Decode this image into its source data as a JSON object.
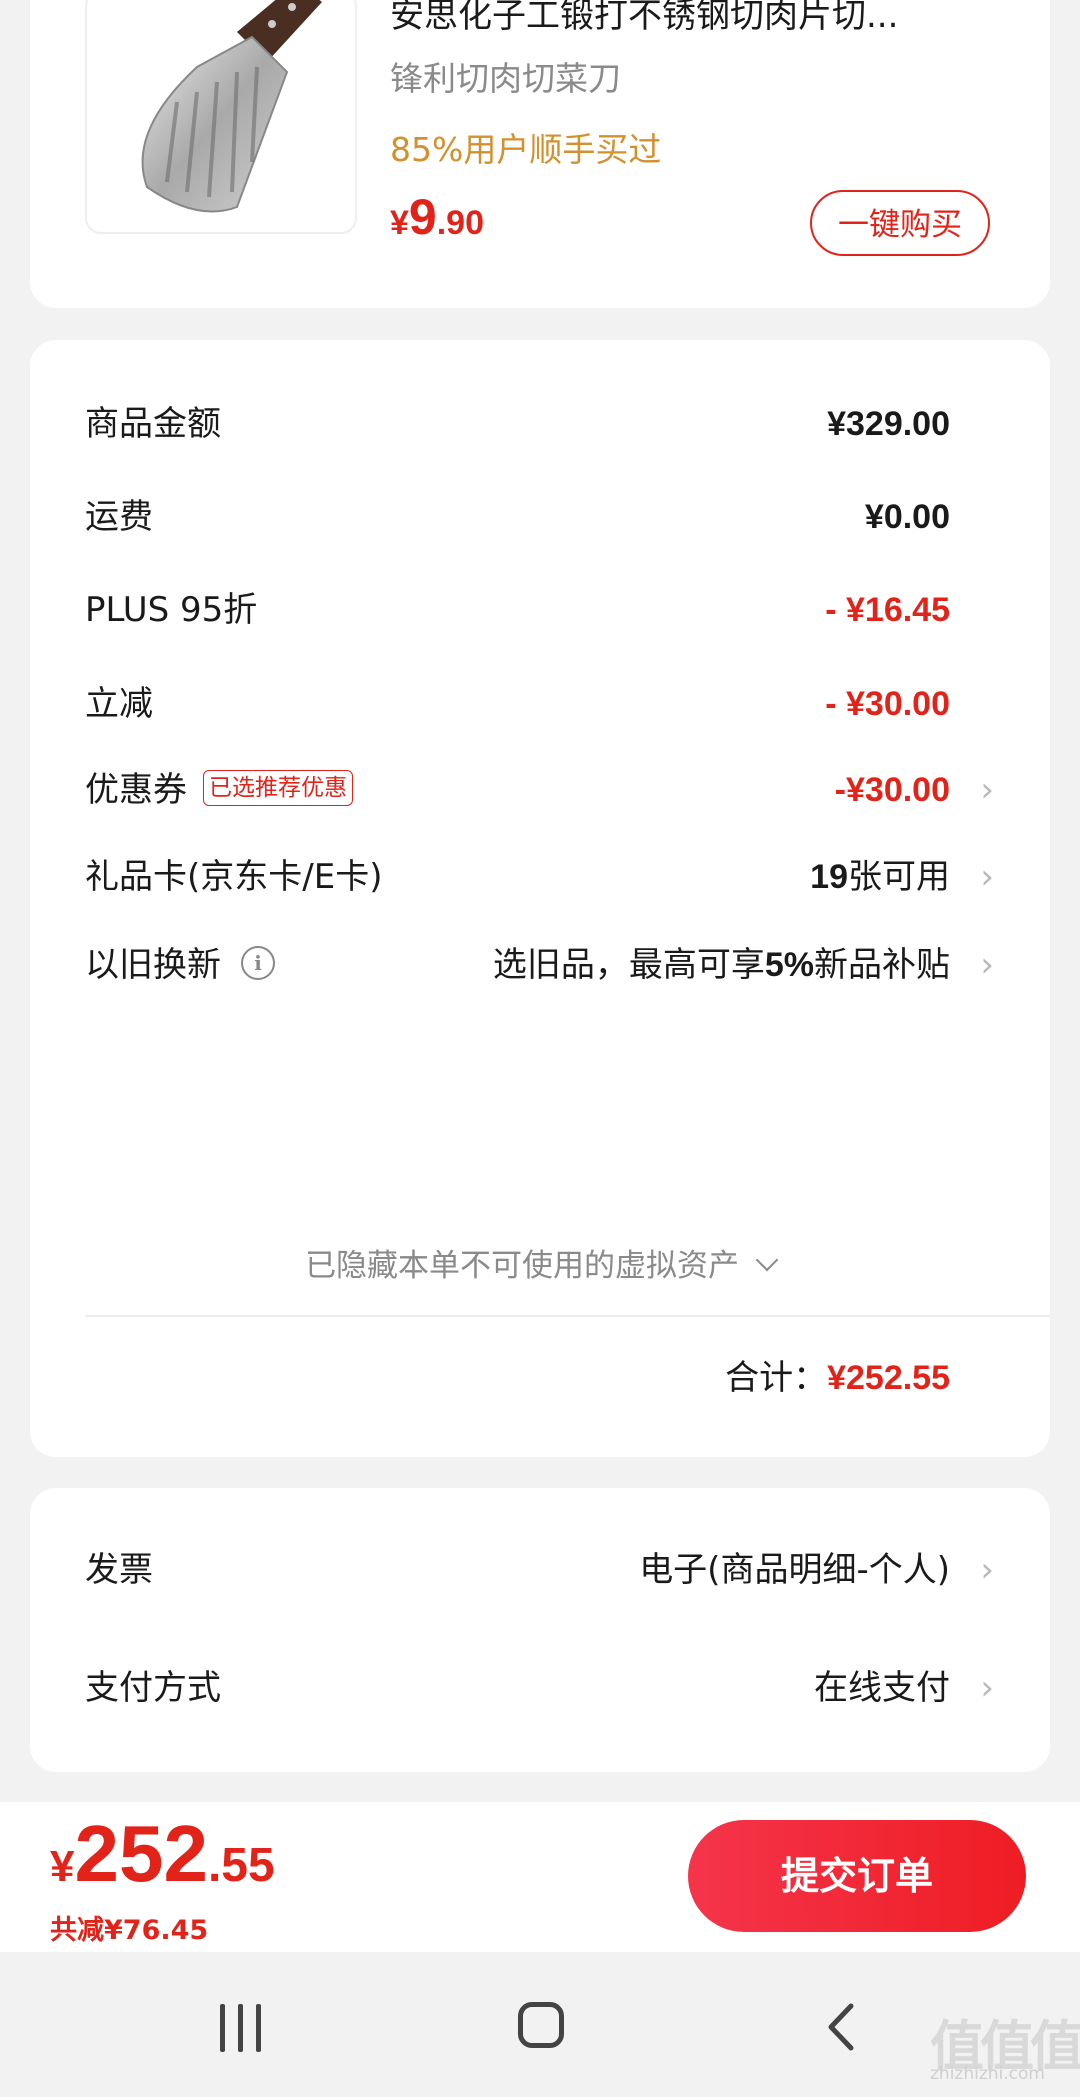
{
  "product": {
    "title": "安思化子工锻打不锈钢切肉片切...",
    "subtitle": "锋利切肉切菜刀",
    "tag": "85%用户顺手买过",
    "price_currency": "¥",
    "price_int": "9",
    "price_dec": ".90",
    "buy_label": "一键购买"
  },
  "summary": {
    "rows": [
      {
        "label": "商品金额",
        "value": "¥329.00"
      },
      {
        "label": "运费",
        "value": "¥0.00"
      },
      {
        "label": "PLUS 95折",
        "value": "- ¥16.45"
      },
      {
        "label": "立减",
        "value": "- ¥30.00"
      },
      {
        "label": "优惠券",
        "badge": "已选推荐优惠",
        "value": "-¥30.00"
      },
      {
        "label": "礼品卡(京东卡/E卡)",
        "value_num": "19",
        "value_text": "张可用"
      },
      {
        "label": "以旧换新",
        "value_pre": "选旧品，最高可享",
        "value_num": "5%",
        "value_post": "新品补贴"
      }
    ],
    "hidden_note": "已隐藏本单不可使用的虚拟资产",
    "total_label": "合计：",
    "total_value": "¥252.55"
  },
  "invoice": {
    "rows": [
      {
        "label": "发票",
        "value": "电子(商品明细-个人)"
      },
      {
        "label": "支付方式",
        "value": "在线支付"
      }
    ]
  },
  "bottom": {
    "currency": "¥",
    "price_int": "252",
    "price_dec": ".55",
    "saved": "共减¥76.45",
    "submit_label": "提交订单"
  },
  "watermark": {
    "logo": "值值值",
    "site": "zhizhizhi.com"
  },
  "colors": {
    "accent_red": "#e2231a",
    "tag_orange": "#d4902c",
    "background": "#f2f2f2"
  },
  "icons": {
    "chevron": "chevron-right-icon",
    "info": "info-icon",
    "dropdown": "chevron-down-icon"
  }
}
